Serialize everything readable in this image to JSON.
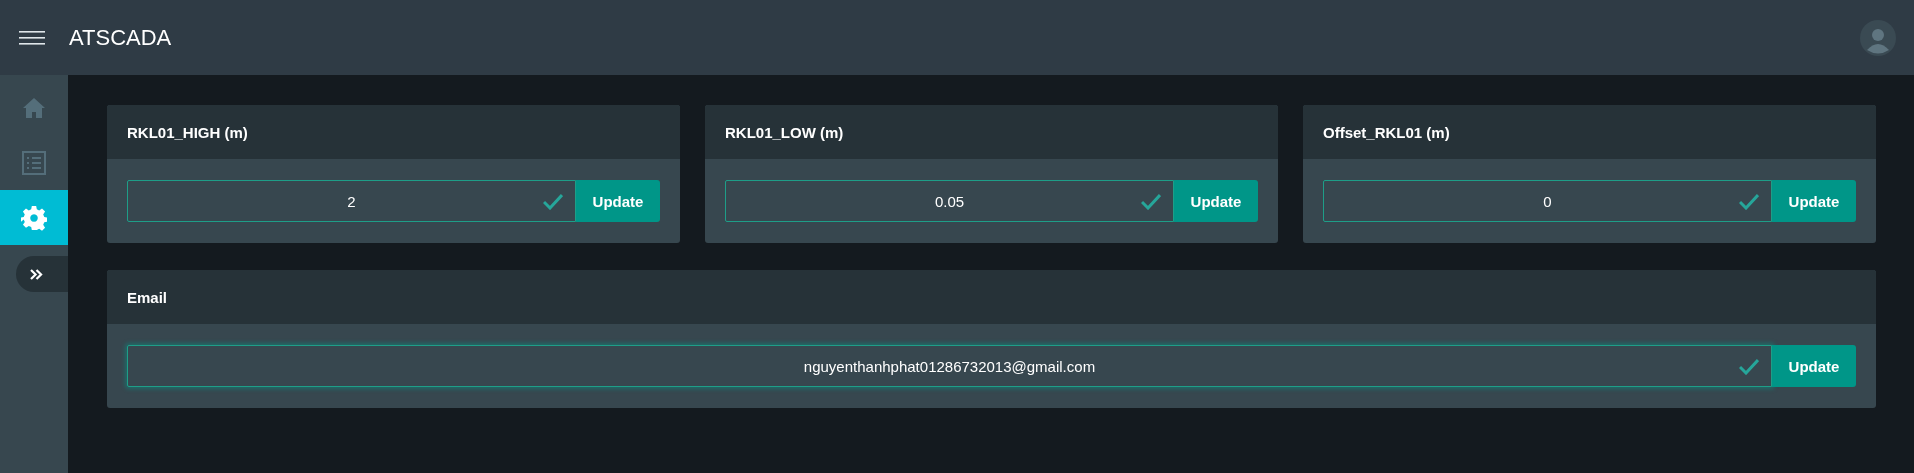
{
  "header": {
    "title": "ATSCADA"
  },
  "sidebar": {
    "items": [
      {
        "kind": "home",
        "selected": false
      },
      {
        "kind": "list",
        "selected": false
      },
      {
        "kind": "settings",
        "selected": true
      }
    ]
  },
  "cards": [
    {
      "title": "RKL01_HIGH (m)",
      "value": "2",
      "valid": true,
      "focused": false,
      "button": "Update",
      "wide": false
    },
    {
      "title": "RKL01_LOW (m)",
      "value": "0.05",
      "valid": true,
      "focused": false,
      "button": "Update",
      "wide": false
    },
    {
      "title": "Offset_RKL01 (m)",
      "value": "0",
      "valid": true,
      "focused": false,
      "button": "Update",
      "wide": false
    },
    {
      "title": "Email",
      "value": "nguyenthanhphat01286732013@gmail.com",
      "valid": true,
      "focused": true,
      "button": "Update",
      "wide": true
    }
  ]
}
